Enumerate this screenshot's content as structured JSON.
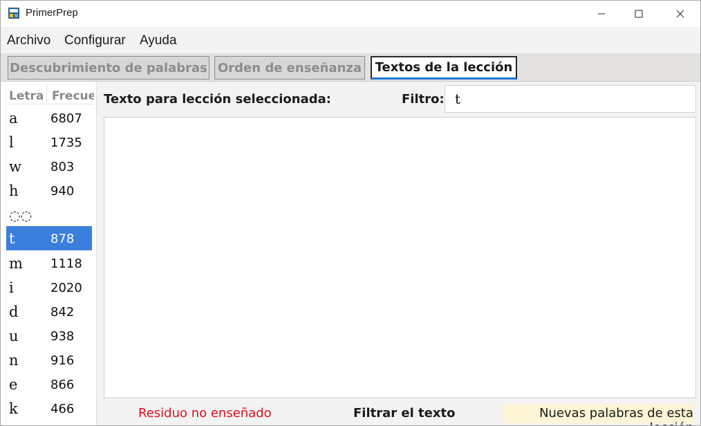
{
  "window": {
    "title": "PrimerPrep"
  },
  "menu": {
    "items": [
      "Archivo",
      "Configurar",
      "Ayuda"
    ]
  },
  "tabs": [
    {
      "label": "Descubrimiento de palabras",
      "active": false
    },
    {
      "label": "Orden de enseñanza",
      "active": false
    },
    {
      "label": "Textos de la lección",
      "active": true
    }
  ],
  "letter_list": {
    "headers": {
      "letter": "Letra",
      "frequency": "Frecuencia"
    },
    "rows": [
      {
        "letter": "a",
        "frequency": "6807"
      },
      {
        "letter": "l",
        "frequency": "1735"
      },
      {
        "letter": "w",
        "frequency": "803"
      },
      {
        "letter": "h",
        "frequency": "940"
      },
      {
        "letter": "◌◌",
        "frequency": ""
      },
      {
        "letter": "t",
        "frequency": "878",
        "selected": true
      },
      {
        "letter": "m",
        "frequency": "1118"
      },
      {
        "letter": "i",
        "frequency": "2020"
      },
      {
        "letter": "d",
        "frequency": "842"
      },
      {
        "letter": "u",
        "frequency": "938"
      },
      {
        "letter": "n",
        "frequency": "916"
      },
      {
        "letter": "e",
        "frequency": "866"
      },
      {
        "letter": "k",
        "frequency": "466"
      }
    ]
  },
  "lesson": {
    "label": "Texto para lección seleccionada:",
    "filter_label": "Filtro:",
    "filter_value": "t",
    "text_content": ""
  },
  "footer": {
    "untaught_residue": "Residuo no enseñado",
    "filter_text": "Filtrar el texto",
    "new_words": "Nuevas palabras de esta lección"
  },
  "colors": {
    "selection": "#3b7fdc",
    "active_tab_underline": "#1e78d4",
    "residue_red": "#e0101d",
    "new_words_bg": "#fdf5d5"
  }
}
